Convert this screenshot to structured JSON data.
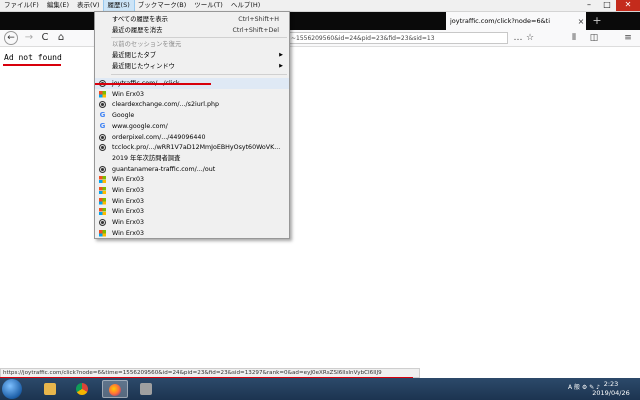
{
  "menubar": {
    "items": [
      "ファイル(F)",
      "編集(E)",
      "表示(V)",
      "履歴(S)",
      "ブックマーク(B)",
      "ツール(T)",
      "ヘルプ(H)"
    ]
  },
  "tab": {
    "title": "joytraffic.com/click?node=6&ti",
    "close": "×"
  },
  "newtab": "+",
  "window": {
    "minimize": "–",
    "maximize": "□",
    "close": "✕"
  },
  "nav": {
    "back": "←",
    "forward": "→",
    "reload": "C",
    "home": "⌂",
    "url": "~1556209560&id=24&pid=23&fid=23&sid=13",
    "icons": [
      "…",
      "☆",
      "⫴",
      "◫",
      "≡"
    ]
  },
  "page": {
    "error_text": "Ad not found"
  },
  "history_menu": {
    "top_items": [
      {
        "label": "すべての履歴を表示",
        "shortcut": "Ctrl+Shift+H"
      },
      {
        "label": "最近の履歴を消去",
        "shortcut": "Ctrl+Shift+Del"
      }
    ],
    "restore_label": "以前のセッションを復元",
    "submenus": [
      {
        "label": "最近閉じたタブ",
        "arrow": "▶"
      },
      {
        "label": "最近閉じたウィンドウ",
        "arrow": "▶"
      }
    ],
    "entries": [
      {
        "label": "joytraffic.com/.../click",
        "icon": "globe-icon"
      },
      {
        "label": "Win Erx03",
        "icon": "windows-icon"
      },
      {
        "label": "cleardexchange.com/.../s2iurl.php",
        "icon": "globe-icon"
      },
      {
        "label": "Google",
        "icon": "google-icon"
      },
      {
        "label": "www.google.com/",
        "icon": "google-icon"
      },
      {
        "label": "orderpixel.com/.../449096440",
        "icon": "globe-icon"
      },
      {
        "label": "tcclock.pro/.../wRR1V7aD12MmJoEBHyOsyt60WoVK...",
        "icon": "globe-icon"
      },
      {
        "label": "2019 年年次訪問者調査",
        "icon": "none"
      },
      {
        "label": "guantanamera-traffic.com/.../out",
        "icon": "globe-icon"
      },
      {
        "label": "Win Erx03",
        "icon": "windows-icon"
      },
      {
        "label": "Win Erx03",
        "icon": "windows-icon"
      },
      {
        "label": "Win Erx03",
        "icon": "windows-icon"
      },
      {
        "label": "Win Erx03",
        "icon": "windows-icon"
      },
      {
        "label": "Win Erx03",
        "icon": "globe-icon"
      },
      {
        "label": "Win Erx03",
        "icon": "windows-icon"
      }
    ]
  },
  "statusbar": {
    "url": "https://joytraffic.com/click?node=6&time=1556209560&id=24&pid=23&fid=23&sid=13297&rank=0&ad=eyJ0eXRsZSI6IlsInVybCI6IlJ9"
  },
  "taskbar": {
    "tray_text": "A 般 ⚙ ✎ ♪",
    "time": "2:23",
    "date": "2019/04/26"
  },
  "colors": {
    "highlight_red": "#d8000c",
    "menu_bg": "#f0f0f0",
    "taskbar": "#1c3450"
  }
}
